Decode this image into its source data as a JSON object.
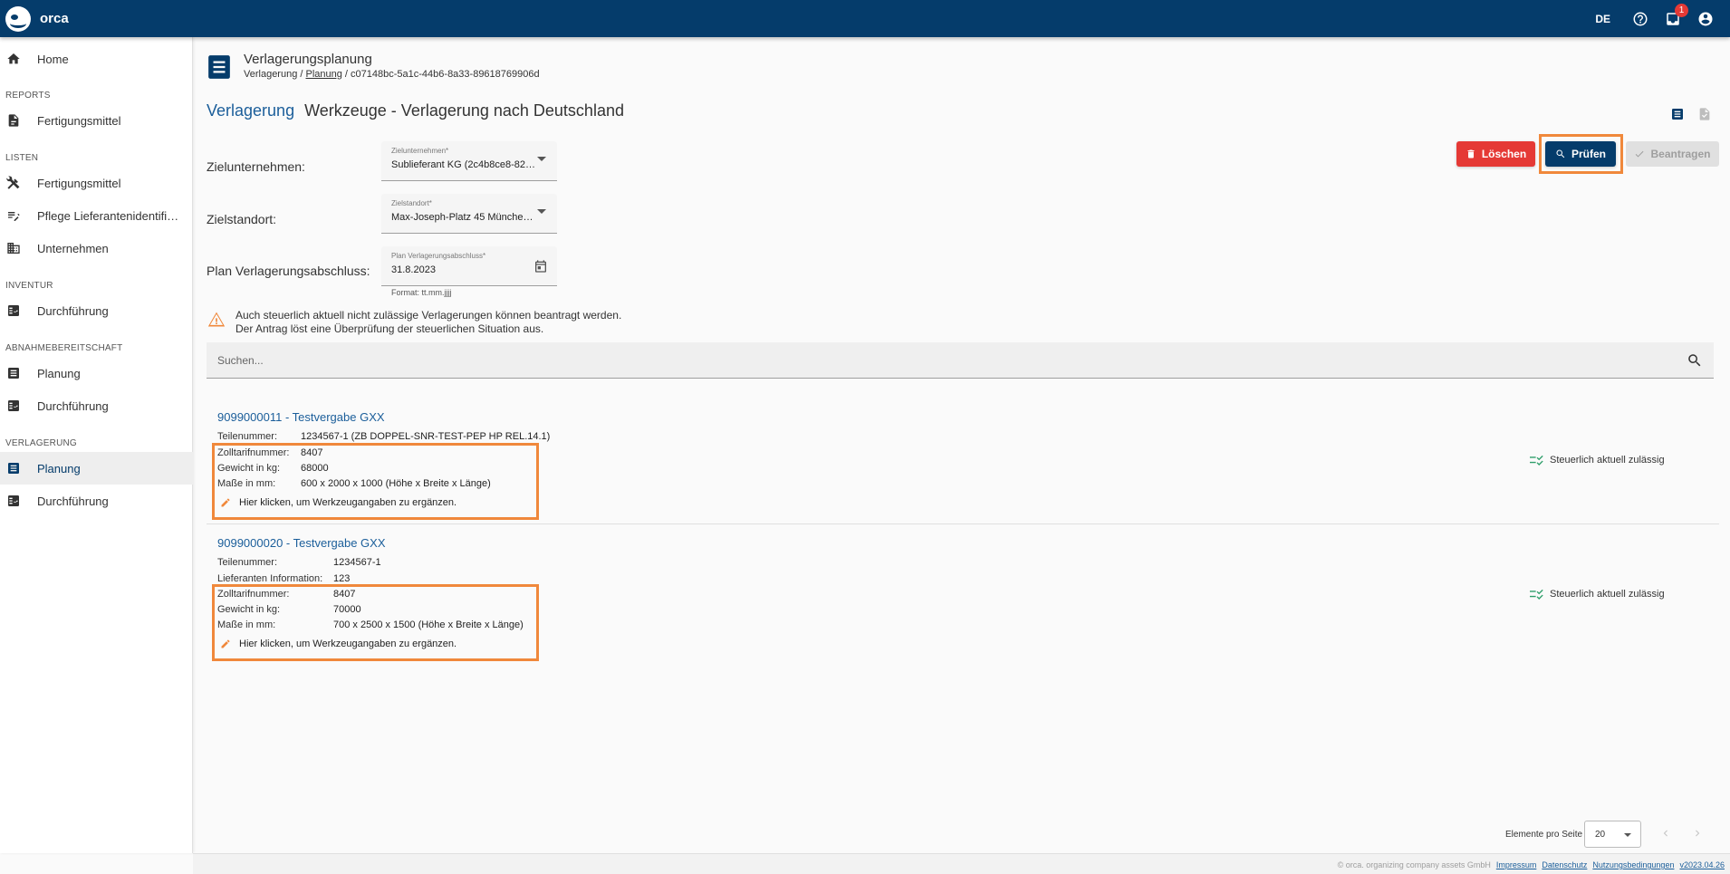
{
  "app": {
    "brand": "orca",
    "language": "DE",
    "notification_count": "1"
  },
  "sidebar": {
    "home": "Home",
    "sections": {
      "reports": "REPORTS",
      "listen": "LISTEN",
      "inventur": "INVENTUR",
      "abnahme": "ABNAHMEBEREITSCHAFT",
      "verlagerung": "VERLAGERUNG"
    },
    "items": {
      "reports_fertigungsmittel": "Fertigungsmittel",
      "listen_fertigungsmittel": "Fertigungsmittel",
      "pflege": "Pflege Lieferantenidentifik...",
      "unternehmen": "Unternehmen",
      "inventur_durchfuehrung": "Durchführung",
      "abnahme_planung": "Planung",
      "abnahme_durchfuehrung": "Durchführung",
      "verlagerung_planung": "Planung",
      "verlagerung_durchfuehrung": "Durchführung"
    }
  },
  "header": {
    "title": "Verlagerungsplanung",
    "breadcrumb_root": "Verlagerung",
    "breadcrumb_sep1": " / ",
    "breadcrumb_link": "Planung",
    "breadcrumb_sep2": " / ",
    "breadcrumb_id": "c07148bc-5a1c-44b6-8a33-89618769906d"
  },
  "heading": {
    "link": "Verlagerung",
    "text": "Werkzeuge - Verlagerung nach Deutschland"
  },
  "buttons": {
    "delete": "Löschen",
    "check": "Prüfen",
    "apply": "Beantragen"
  },
  "form": {
    "target_company": {
      "label": "Zielunternehmen:",
      "float_label": "Zielunternehmen*",
      "value": "Sublieferant KG (2c4b8ce8-82d..."
    },
    "target_location": {
      "label": "Zielstandort:",
      "float_label": "Zielstandort*",
      "value": "Max-Joseph-Platz 45 München ..."
    },
    "plan_date": {
      "label": "Plan Verlagerungsabschluss:",
      "float_label": "Plan Verlagerungsabschluss*",
      "value": "31.8.2023",
      "hint": "Format: tt.mm.jjjj"
    }
  },
  "warning": {
    "line1": "Auch steuerlich aktuell nicht zulässige Verlagerungen können beantragt werden.",
    "line2": "Der Antrag löst eine Überprüfung der steuerlichen Situation aus."
  },
  "search": {
    "placeholder": "Suchen..."
  },
  "items": [
    {
      "title": "9099000011 - Testvergabe GXX",
      "teilenummer_label": "Teilenummer:",
      "teilenummer": "1234567-1 (ZB DOPPEL-SNR-TEST-PEP HP REL.14.1)",
      "zoll_label": "Zolltarifnummer:",
      "zoll": "8407",
      "gewicht_label": "Gewicht in kg:",
      "gewicht": "68000",
      "masse_label": "Maße in mm:",
      "masse": "600 x 2000 x 1000 (Höhe x Breite x Länge)",
      "edit": "Hier klicken, um Werkzeugangaben zu ergänzen.",
      "status": "Steuerlich aktuell zulässig"
    },
    {
      "title": "9099000020 - Testvergabe GXX",
      "teilenummer_label": "Teilenummer:",
      "teilenummer": "1234567-1",
      "lieferant_label": "Lieferanten Information:",
      "lieferant": "123",
      "zoll_label": "Zolltarifnummer:",
      "zoll": "8407",
      "gewicht_label": "Gewicht in kg:",
      "gewicht": "70000",
      "masse_label": "Maße in mm:",
      "masse": "700 x 2500 x 1500 (Höhe x Breite x Länge)",
      "edit": "Hier klicken, um Werkzeugangaben zu ergänzen.",
      "status": "Steuerlich aktuell zulässig"
    }
  ],
  "pagination": {
    "label": "Elemente pro Seite",
    "page_size": "20"
  },
  "footer": {
    "copyright": "© orca. organizing company assets GmbH",
    "impressum": "Impressum",
    "datenschutz": "Datenschutz",
    "nutzung": "Nutzungsbedingungen",
    "version": "v2023.04.26"
  },
  "colors": {
    "primary": "#053c6b",
    "link": "#1b5e9a",
    "danger": "#e53935",
    "highlight": "#f0883b",
    "success": "#2e9e6a"
  },
  "icons": [
    "home-icon",
    "report-icon",
    "tools-icon",
    "edit-list-icon",
    "building-icon",
    "checklist-icon",
    "list-icon",
    "help-icon",
    "inbox-icon",
    "account-icon",
    "calendar-icon",
    "warning-icon",
    "search-icon",
    "pencil-icon",
    "rule-check-icon"
  ]
}
